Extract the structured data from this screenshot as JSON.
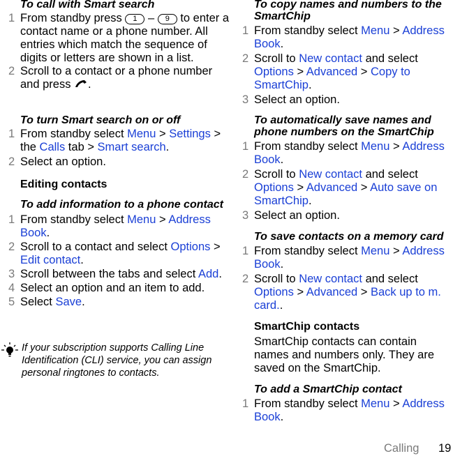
{
  "left_column": {
    "smart_search_call": {
      "heading": "To call with Smart search",
      "steps": [
        {
          "num": "1",
          "parts": [
            "From standby press ",
            " – ",
            " to enter a contact name or a phone number. All entries which match the sequence of digits or letters are shown in a list."
          ],
          "keys": [
            "1",
            "9"
          ]
        },
        {
          "num": "2",
          "text": "Scroll to a contact or a phone number and press ",
          "end": ".",
          "icon": "call-key-icon"
        }
      ]
    },
    "smart_search_toggle": {
      "heading": "To turn Smart search on or off",
      "steps": [
        {
          "num": "1",
          "t1": "From standby select ",
          "l1": "Menu",
          "t2": " > ",
          "l2": "Settings",
          "t3": " > the ",
          "l3": "Calls",
          "t4": " tab > ",
          "l4": "Smart search",
          "t5": "."
        },
        {
          "num": "2",
          "text": "Select an option."
        }
      ]
    },
    "editing_contacts": {
      "heading": "Editing contacts"
    },
    "add_info": {
      "heading": "To add information to a phone contact",
      "steps": [
        {
          "num": "1",
          "t1": "From standby select ",
          "l1": "Menu",
          "t2": " > ",
          "l2": "Address Book",
          "t3": "."
        },
        {
          "num": "2",
          "t1": "Scroll to a contact and select ",
          "l1": "Options",
          "t2": " > ",
          "l2": "Edit contact",
          "t3": "."
        },
        {
          "num": "3",
          "t1": "Scroll between the tabs and select ",
          "l1": "Add",
          "t2": "."
        },
        {
          "num": "4",
          "text": "Select an option and an item to add."
        },
        {
          "num": "5",
          "t1": "Select ",
          "l1": "Save",
          "t2": "."
        }
      ]
    },
    "tip": {
      "icon": "lightbulb-icon",
      "text": "If your subscription supports Calling Line Identification (CLI) service, you can assign personal ringtones to contacts."
    }
  },
  "right_column": {
    "copy_to_chip": {
      "heading": "To copy names and numbers to the SmartChip",
      "steps": [
        {
          "num": "1",
          "t1": "From standby select ",
          "l1": "Menu",
          "t2": " > ",
          "l2": "Address Book",
          "t3": "."
        },
        {
          "num": "2",
          "t1": "Scroll to ",
          "l1": "New contact",
          "t2": " and select ",
          "l2": "Options",
          "t3": " > ",
          "l3": "Advanced",
          "t4": " > ",
          "l4": "Copy to SmartChip",
          "t5": "."
        },
        {
          "num": "3",
          "text": "Select an option."
        }
      ]
    },
    "auto_save": {
      "heading": "To automatically save names and phone numbers on the SmartChip",
      "steps": [
        {
          "num": "1",
          "t1": "From standby select ",
          "l1": "Menu",
          "t2": " > ",
          "l2": "Address Book",
          "t3": "."
        },
        {
          "num": "2",
          "t1": "Scroll to ",
          "l1": "New contact",
          "t2": " and select ",
          "l2": "Options",
          "t3": " > ",
          "l3": "Advanced",
          "t4": " > ",
          "l4": "Auto save on SmartChip",
          "t5": "."
        },
        {
          "num": "3",
          "text": "Select an option."
        }
      ]
    },
    "memory_card": {
      "heading": "To save contacts on a memory card",
      "steps": [
        {
          "num": "1",
          "t1": "From standby select ",
          "l1": "Menu",
          "t2": " > ",
          "l2": "Address Book",
          "t3": "."
        },
        {
          "num": "2",
          "t1": "Scroll to ",
          "l1": "New contact",
          "t2": " and select ",
          "l2": "Options",
          "t3": " > ",
          "l3": "Advanced",
          "t4": " > ",
          "l4": "Back up to m. card.",
          "t5": "."
        }
      ]
    },
    "smartchip_contacts": {
      "heading": "SmartChip contacts",
      "body": "SmartChip contacts can contain names and numbers only. They are saved on the SmartChip."
    },
    "add_chip_contact": {
      "heading": "To add a SmartChip contact",
      "steps": [
        {
          "num": "1",
          "t1": "From standby select ",
          "l1": "Menu",
          "t2": " > ",
          "l2": "Address Book",
          "t3": "."
        }
      ]
    }
  },
  "footer": {
    "section": "Calling",
    "page": "19"
  },
  "colors": {
    "link": "#1a3fd6",
    "step_number": "#7a7a7a",
    "text": "#000000"
  }
}
